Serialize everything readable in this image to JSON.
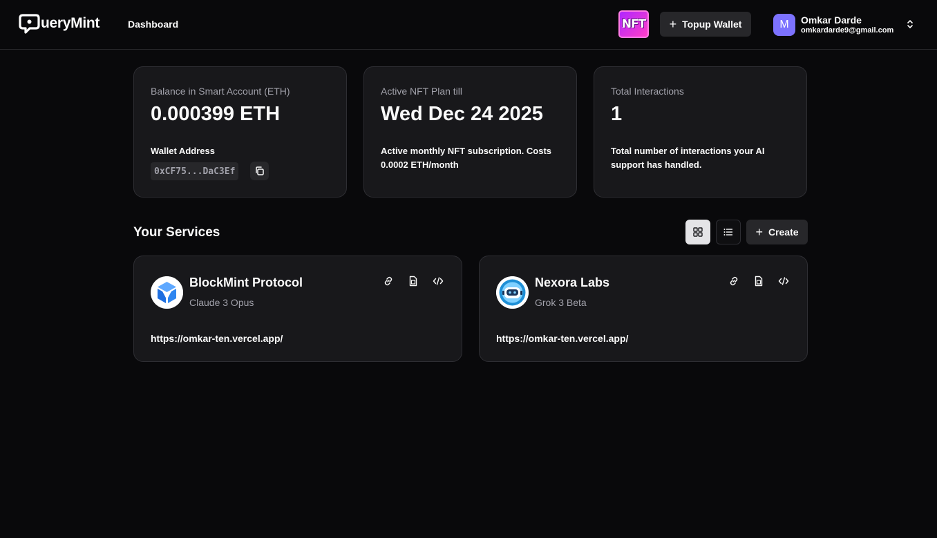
{
  "header": {
    "brand": "ueryMint",
    "nav": {
      "dashboard": "Dashboard"
    },
    "nft_badge": "NFT",
    "topup_label": "Topup Wallet",
    "user": {
      "initial": "M",
      "name": "Omkar Darde",
      "email": "omkardarde9@gmail.com"
    }
  },
  "stats": [
    {
      "label": "Balance in Smart Account (ETH)",
      "value": "0.000399 ETH",
      "sub": "Wallet Address",
      "wallet": "0xCF75...DaC3Ef"
    },
    {
      "label": "Active NFT Plan till",
      "value": "Wed Dec 24 2025",
      "sub": "Active monthly NFT subscription. Costs 0.0002 ETH/month"
    },
    {
      "label": "Total Interactions",
      "value": "1",
      "sub": "Total number of interactions your AI support has handled."
    }
  ],
  "services": {
    "title": "Your Services",
    "create_label": "Create",
    "items": [
      {
        "name": "BlockMint Protocol",
        "model": "Claude 3 Opus",
        "url": "https://omkar-ten.vercel.app/"
      },
      {
        "name": "Nexora Labs",
        "model": "Grok 3 Beta",
        "url": "https://omkar-ten.vercel.app/"
      }
    ]
  },
  "colors": {
    "background": "#09090b",
    "card": "#18181b",
    "border": "#2e2e33",
    "muted": "#a1a1aa",
    "avatar": "#7c72ff",
    "nft": "#d12cf0"
  }
}
